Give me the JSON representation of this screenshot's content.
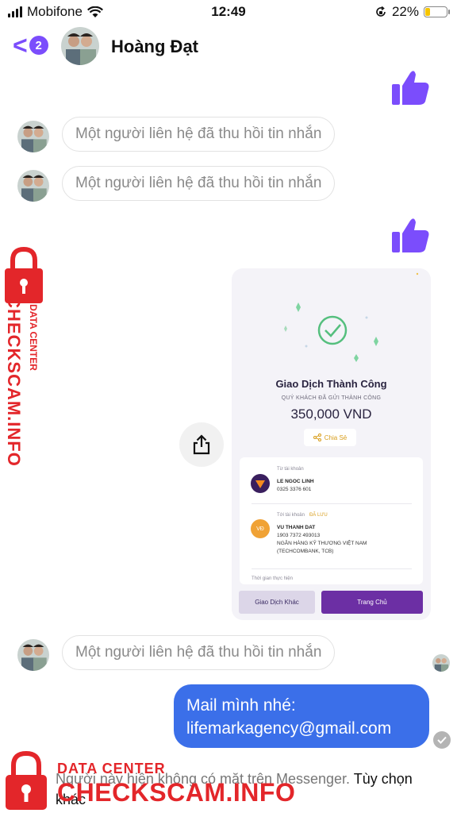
{
  "status_bar": {
    "carrier": "Mobifone",
    "time": "12:49",
    "battery_percent": "22%",
    "battery_level": 0.22
  },
  "header": {
    "back_badge": "2",
    "contact_name": "Hoàng Đạt"
  },
  "messages": {
    "recalled_1": "Một người liên hệ đã thu hồi tin nhắn",
    "recalled_2": "Một người liên hệ đã thu hồi tin nhắn",
    "recalled_3": "Một người liên hệ đã thu hồi tin nhắn",
    "outgoing": {
      "line1": "Mail mình nhé:",
      "line2": "lifemarkagency@gmail.com"
    }
  },
  "receipt": {
    "title": "Giao Dịch Thành Công",
    "subtitle": "QUÝ KHÁCH ĐÃ GỬI THÀNH CÔNG",
    "amount": "350,000 VND",
    "share_label": "Chia Sẻ",
    "from_label": "Từ tài khoản",
    "from_name": "LE NGOC LINH",
    "from_account": "0325 3376 601",
    "to_label": "Tới tài khoản",
    "to_saved": "ĐÃ LƯU",
    "to_initials": "VĐ",
    "to_name": "VU THANH DAT",
    "to_account": "1903 7372 493013",
    "to_bank": "NGÂN HÀNG KỸ THƯƠNG VIỆT NAM",
    "to_bank_short": "(TECHCOMBANK, TCB)",
    "time_label": "Thời gian thực hiện",
    "btn_other": "Giao Dịch Khác",
    "btn_home": "Trang Chủ"
  },
  "footer": {
    "note": "Người này hiện không có mặt trên Messenger.",
    "action": "Tùy chọn khác"
  },
  "watermark": {
    "brand": "CHECKSCAM.INFO",
    "tag": "DATA CENTER"
  },
  "colors": {
    "accent": "#7b4dfc",
    "bubble": "#3b6fe9",
    "watermark": "#e3262a"
  }
}
